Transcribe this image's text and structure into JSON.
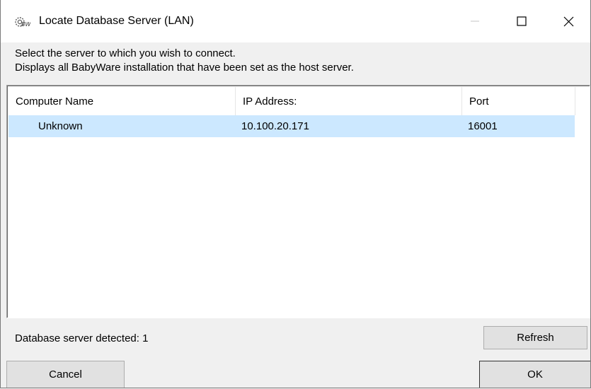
{
  "window": {
    "title": "Locate Database Server (LAN)",
    "app_icon_text": "BW",
    "controls": {
      "minimize": "minimize-icon",
      "maximize": "maximize-icon",
      "close": "close-icon"
    }
  },
  "info": {
    "line1": "Select the server to which you wish to connect.",
    "line2": "Displays all BabyWare installation that have been set as the host server."
  },
  "table": {
    "columns": [
      "Computer Name",
      "IP Address:",
      "Port"
    ],
    "rows": [
      {
        "name": "Unknown",
        "ip": "10.100.20.171",
        "port": "16001",
        "selected": true
      }
    ]
  },
  "status": {
    "text": "Database server detected: 1"
  },
  "buttons": {
    "refresh": "Refresh",
    "cancel": "Cancel",
    "ok": "OK"
  },
  "colors": {
    "selection": "#cce8ff",
    "background": "#f0f0f0",
    "button": "#e1e1e1"
  }
}
